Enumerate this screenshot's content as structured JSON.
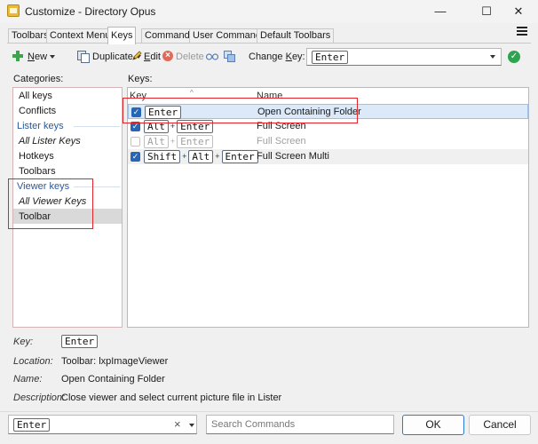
{
  "window": {
    "title": "Customize - Directory Opus",
    "minimize_glyph": "—",
    "maximize_glyph": "☐",
    "close_glyph": "✕"
  },
  "tabs": [
    {
      "label": "Toolbars"
    },
    {
      "label": "Context Menus"
    },
    {
      "label": "Keys"
    },
    {
      "label": "Commands"
    },
    {
      "label": "User Commands"
    },
    {
      "label": "Default Toolbars"
    }
  ],
  "active_tab": "Keys",
  "toolbar": {
    "new_label": "New",
    "new_underline": "N",
    "new_rest": "ew",
    "duplicate_label": "Duplicate",
    "edit_label": "Edit",
    "edit_underline": "E",
    "edit_rest": "dit",
    "delete_label": "Delete",
    "change_key_label": "Change ",
    "change_key_underline": "K",
    "change_key_rest": "ey:",
    "change_key_value": "Enter"
  },
  "categories": {
    "label": "Categories:",
    "items": [
      {
        "label": "All keys",
        "italic": false
      },
      {
        "label": "Conflicts",
        "italic": false
      }
    ],
    "lister_heading": "Lister keys",
    "lister_items": [
      {
        "label": "All Lister Keys",
        "italic": true
      },
      {
        "label": "Hotkeys",
        "italic": false
      },
      {
        "label": "Toolbars",
        "italic": false
      }
    ],
    "viewer_heading": "Viewer keys",
    "viewer_items": [
      {
        "label": "All Viewer Keys",
        "italic": true
      },
      {
        "label": "Toolbar",
        "italic": false,
        "selected": true
      }
    ]
  },
  "keys_panel": {
    "label": "Keys:",
    "col_key": "Key",
    "col_name": "Name",
    "sort_glyph": "^",
    "plus_glyph": "+",
    "rows": [
      {
        "keys": [
          "Enter"
        ],
        "name": "Open Containing Folder",
        "checked": true,
        "enabled": true,
        "selected": true
      },
      {
        "keys": [
          "Alt",
          "Enter"
        ],
        "name": "Full Screen",
        "checked": true,
        "enabled": true,
        "selected": false
      },
      {
        "keys": [
          "Alt",
          "Enter"
        ],
        "name": "Full Screen",
        "checked": false,
        "enabled": false,
        "selected": false
      },
      {
        "keys": [
          "Shift",
          "Alt",
          "Enter"
        ],
        "name": "Full Screen Multi",
        "checked": true,
        "enabled": true,
        "selected": false
      }
    ]
  },
  "details": {
    "key_label": "Key:",
    "key_value": "Enter",
    "location_label": "Location:",
    "location_value": "Toolbar: lxpImageViewer",
    "name_label": "Name:",
    "name_value": "Open Containing Folder",
    "description_label": "Description:",
    "description_value": "Close viewer and select current picture file in Lister"
  },
  "bottom": {
    "key_filter_value": "Enter",
    "clear_glyph": "×",
    "search_placeholder": "Search Commands",
    "ok_label": "OK",
    "cancel_label": "Cancel"
  },
  "colors": {
    "accent": "#2b78d8",
    "highlight_box": "#e0242a",
    "selected_row": "#dbe9f8",
    "heading_blue": "#2b5797"
  }
}
